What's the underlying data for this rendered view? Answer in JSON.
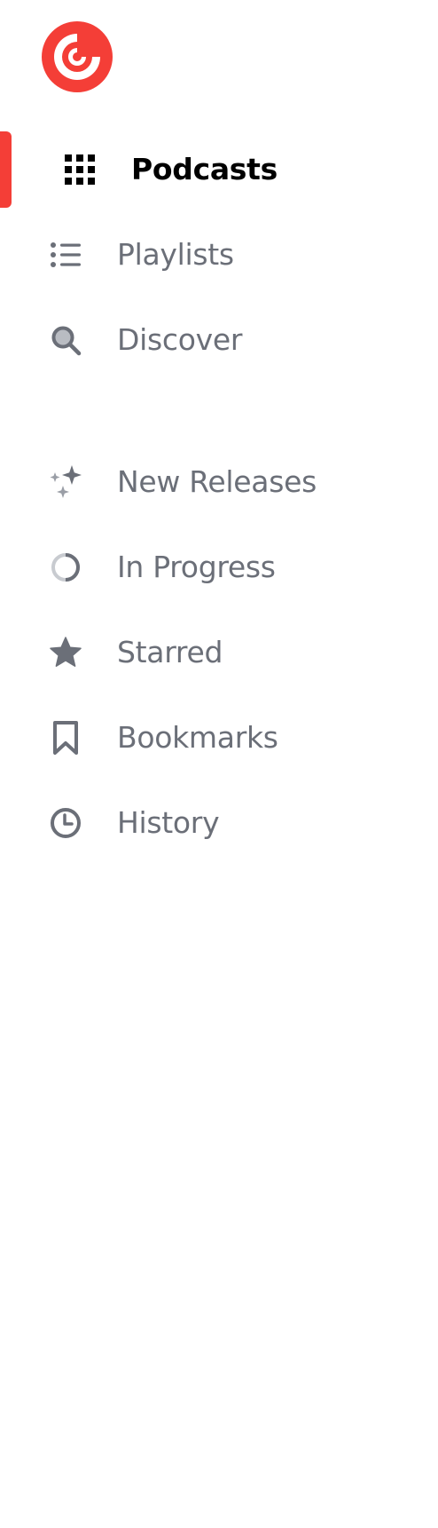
{
  "colors": {
    "brand": "#f43e37",
    "active_text": "#000000",
    "inactive_text": "#6b6f78",
    "inactive_icon": "#6b6f78",
    "background": "#ffffff"
  },
  "logo": {
    "icon": "pocket-casts-logo"
  },
  "nav": {
    "primary": [
      {
        "label": "Podcasts",
        "icon": "grid-icon",
        "active": true
      },
      {
        "label": "Playlists",
        "icon": "list-icon",
        "active": false
      },
      {
        "label": "Discover",
        "icon": "search-icon",
        "active": false
      }
    ],
    "library": [
      {
        "label": "New Releases",
        "icon": "sparkle-icon"
      },
      {
        "label": "In Progress",
        "icon": "progress-icon"
      },
      {
        "label": "Starred",
        "icon": "star-icon"
      },
      {
        "label": "Bookmarks",
        "icon": "bookmark-icon"
      },
      {
        "label": "History",
        "icon": "clock-icon"
      }
    ]
  }
}
